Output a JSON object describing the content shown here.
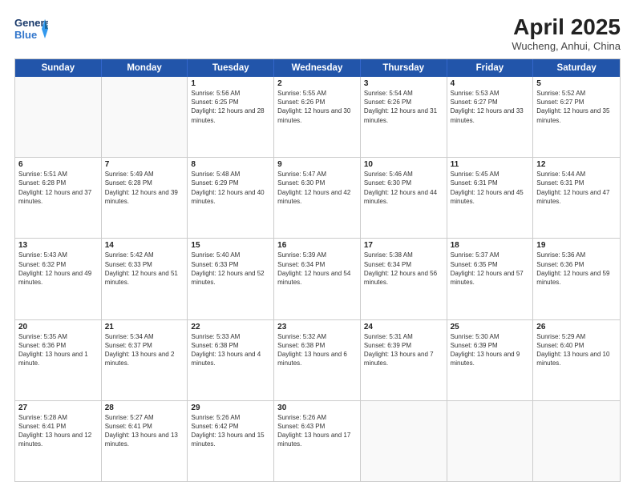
{
  "logo": {
    "line1": "General",
    "line2": "Blue"
  },
  "title": "April 2025",
  "subtitle": "Wucheng, Anhui, China",
  "days": [
    "Sunday",
    "Monday",
    "Tuesday",
    "Wednesday",
    "Thursday",
    "Friday",
    "Saturday"
  ],
  "weeks": [
    [
      {
        "num": "",
        "info": ""
      },
      {
        "num": "",
        "info": ""
      },
      {
        "num": "1",
        "info": "Sunrise: 5:56 AM\nSunset: 6:25 PM\nDaylight: 12 hours and 28 minutes."
      },
      {
        "num": "2",
        "info": "Sunrise: 5:55 AM\nSunset: 6:26 PM\nDaylight: 12 hours and 30 minutes."
      },
      {
        "num": "3",
        "info": "Sunrise: 5:54 AM\nSunset: 6:26 PM\nDaylight: 12 hours and 31 minutes."
      },
      {
        "num": "4",
        "info": "Sunrise: 5:53 AM\nSunset: 6:27 PM\nDaylight: 12 hours and 33 minutes."
      },
      {
        "num": "5",
        "info": "Sunrise: 5:52 AM\nSunset: 6:27 PM\nDaylight: 12 hours and 35 minutes."
      }
    ],
    [
      {
        "num": "6",
        "info": "Sunrise: 5:51 AM\nSunset: 6:28 PM\nDaylight: 12 hours and 37 minutes."
      },
      {
        "num": "7",
        "info": "Sunrise: 5:49 AM\nSunset: 6:28 PM\nDaylight: 12 hours and 39 minutes."
      },
      {
        "num": "8",
        "info": "Sunrise: 5:48 AM\nSunset: 6:29 PM\nDaylight: 12 hours and 40 minutes."
      },
      {
        "num": "9",
        "info": "Sunrise: 5:47 AM\nSunset: 6:30 PM\nDaylight: 12 hours and 42 minutes."
      },
      {
        "num": "10",
        "info": "Sunrise: 5:46 AM\nSunset: 6:30 PM\nDaylight: 12 hours and 44 minutes."
      },
      {
        "num": "11",
        "info": "Sunrise: 5:45 AM\nSunset: 6:31 PM\nDaylight: 12 hours and 45 minutes."
      },
      {
        "num": "12",
        "info": "Sunrise: 5:44 AM\nSunset: 6:31 PM\nDaylight: 12 hours and 47 minutes."
      }
    ],
    [
      {
        "num": "13",
        "info": "Sunrise: 5:43 AM\nSunset: 6:32 PM\nDaylight: 12 hours and 49 minutes."
      },
      {
        "num": "14",
        "info": "Sunrise: 5:42 AM\nSunset: 6:33 PM\nDaylight: 12 hours and 51 minutes."
      },
      {
        "num": "15",
        "info": "Sunrise: 5:40 AM\nSunset: 6:33 PM\nDaylight: 12 hours and 52 minutes."
      },
      {
        "num": "16",
        "info": "Sunrise: 5:39 AM\nSunset: 6:34 PM\nDaylight: 12 hours and 54 minutes."
      },
      {
        "num": "17",
        "info": "Sunrise: 5:38 AM\nSunset: 6:34 PM\nDaylight: 12 hours and 56 minutes."
      },
      {
        "num": "18",
        "info": "Sunrise: 5:37 AM\nSunset: 6:35 PM\nDaylight: 12 hours and 57 minutes."
      },
      {
        "num": "19",
        "info": "Sunrise: 5:36 AM\nSunset: 6:36 PM\nDaylight: 12 hours and 59 minutes."
      }
    ],
    [
      {
        "num": "20",
        "info": "Sunrise: 5:35 AM\nSunset: 6:36 PM\nDaylight: 13 hours and 1 minute."
      },
      {
        "num": "21",
        "info": "Sunrise: 5:34 AM\nSunset: 6:37 PM\nDaylight: 13 hours and 2 minutes."
      },
      {
        "num": "22",
        "info": "Sunrise: 5:33 AM\nSunset: 6:38 PM\nDaylight: 13 hours and 4 minutes."
      },
      {
        "num": "23",
        "info": "Sunrise: 5:32 AM\nSunset: 6:38 PM\nDaylight: 13 hours and 6 minutes."
      },
      {
        "num": "24",
        "info": "Sunrise: 5:31 AM\nSunset: 6:39 PM\nDaylight: 13 hours and 7 minutes."
      },
      {
        "num": "25",
        "info": "Sunrise: 5:30 AM\nSunset: 6:39 PM\nDaylight: 13 hours and 9 minutes."
      },
      {
        "num": "26",
        "info": "Sunrise: 5:29 AM\nSunset: 6:40 PM\nDaylight: 13 hours and 10 minutes."
      }
    ],
    [
      {
        "num": "27",
        "info": "Sunrise: 5:28 AM\nSunset: 6:41 PM\nDaylight: 13 hours and 12 minutes."
      },
      {
        "num": "28",
        "info": "Sunrise: 5:27 AM\nSunset: 6:41 PM\nDaylight: 13 hours and 13 minutes."
      },
      {
        "num": "29",
        "info": "Sunrise: 5:26 AM\nSunset: 6:42 PM\nDaylight: 13 hours and 15 minutes."
      },
      {
        "num": "30",
        "info": "Sunrise: 5:26 AM\nSunset: 6:43 PM\nDaylight: 13 hours and 17 minutes."
      },
      {
        "num": "",
        "info": ""
      },
      {
        "num": "",
        "info": ""
      },
      {
        "num": "",
        "info": ""
      }
    ]
  ]
}
